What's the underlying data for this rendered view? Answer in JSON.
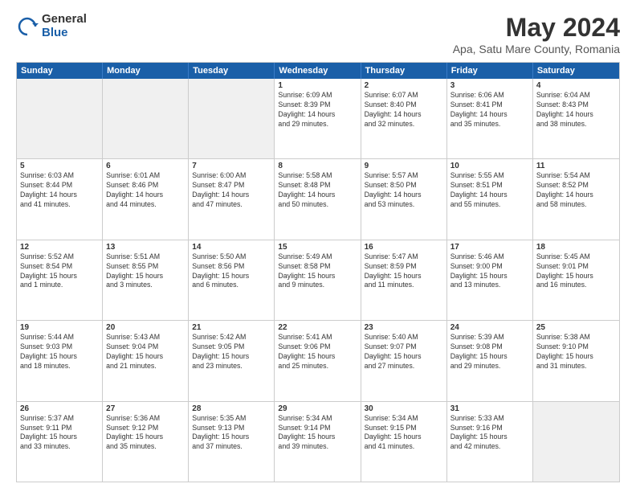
{
  "logo": {
    "general": "General",
    "blue": "Blue"
  },
  "title": "May 2024",
  "subtitle": "Apa, Satu Mare County, Romania",
  "days": [
    "Sunday",
    "Monday",
    "Tuesday",
    "Wednesday",
    "Thursday",
    "Friday",
    "Saturday"
  ],
  "weeks": [
    [
      {
        "day": "",
        "content": "",
        "shaded": true
      },
      {
        "day": "",
        "content": "",
        "shaded": true
      },
      {
        "day": "",
        "content": "",
        "shaded": true
      },
      {
        "day": "1",
        "content": "Sunrise: 6:09 AM\nSunset: 8:39 PM\nDaylight: 14 hours\nand 29 minutes."
      },
      {
        "day": "2",
        "content": "Sunrise: 6:07 AM\nSunset: 8:40 PM\nDaylight: 14 hours\nand 32 minutes."
      },
      {
        "day": "3",
        "content": "Sunrise: 6:06 AM\nSunset: 8:41 PM\nDaylight: 14 hours\nand 35 minutes."
      },
      {
        "day": "4",
        "content": "Sunrise: 6:04 AM\nSunset: 8:43 PM\nDaylight: 14 hours\nand 38 minutes."
      }
    ],
    [
      {
        "day": "5",
        "content": "Sunrise: 6:03 AM\nSunset: 8:44 PM\nDaylight: 14 hours\nand 41 minutes."
      },
      {
        "day": "6",
        "content": "Sunrise: 6:01 AM\nSunset: 8:46 PM\nDaylight: 14 hours\nand 44 minutes."
      },
      {
        "day": "7",
        "content": "Sunrise: 6:00 AM\nSunset: 8:47 PM\nDaylight: 14 hours\nand 47 minutes."
      },
      {
        "day": "8",
        "content": "Sunrise: 5:58 AM\nSunset: 8:48 PM\nDaylight: 14 hours\nand 50 minutes."
      },
      {
        "day": "9",
        "content": "Sunrise: 5:57 AM\nSunset: 8:50 PM\nDaylight: 14 hours\nand 53 minutes."
      },
      {
        "day": "10",
        "content": "Sunrise: 5:55 AM\nSunset: 8:51 PM\nDaylight: 14 hours\nand 55 minutes."
      },
      {
        "day": "11",
        "content": "Sunrise: 5:54 AM\nSunset: 8:52 PM\nDaylight: 14 hours\nand 58 minutes."
      }
    ],
    [
      {
        "day": "12",
        "content": "Sunrise: 5:52 AM\nSunset: 8:54 PM\nDaylight: 15 hours\nand 1 minute."
      },
      {
        "day": "13",
        "content": "Sunrise: 5:51 AM\nSunset: 8:55 PM\nDaylight: 15 hours\nand 3 minutes."
      },
      {
        "day": "14",
        "content": "Sunrise: 5:50 AM\nSunset: 8:56 PM\nDaylight: 15 hours\nand 6 minutes."
      },
      {
        "day": "15",
        "content": "Sunrise: 5:49 AM\nSunset: 8:58 PM\nDaylight: 15 hours\nand 9 minutes."
      },
      {
        "day": "16",
        "content": "Sunrise: 5:47 AM\nSunset: 8:59 PM\nDaylight: 15 hours\nand 11 minutes."
      },
      {
        "day": "17",
        "content": "Sunrise: 5:46 AM\nSunset: 9:00 PM\nDaylight: 15 hours\nand 13 minutes."
      },
      {
        "day": "18",
        "content": "Sunrise: 5:45 AM\nSunset: 9:01 PM\nDaylight: 15 hours\nand 16 minutes."
      }
    ],
    [
      {
        "day": "19",
        "content": "Sunrise: 5:44 AM\nSunset: 9:03 PM\nDaylight: 15 hours\nand 18 minutes."
      },
      {
        "day": "20",
        "content": "Sunrise: 5:43 AM\nSunset: 9:04 PM\nDaylight: 15 hours\nand 21 minutes."
      },
      {
        "day": "21",
        "content": "Sunrise: 5:42 AM\nSunset: 9:05 PM\nDaylight: 15 hours\nand 23 minutes."
      },
      {
        "day": "22",
        "content": "Sunrise: 5:41 AM\nSunset: 9:06 PM\nDaylight: 15 hours\nand 25 minutes."
      },
      {
        "day": "23",
        "content": "Sunrise: 5:40 AM\nSunset: 9:07 PM\nDaylight: 15 hours\nand 27 minutes."
      },
      {
        "day": "24",
        "content": "Sunrise: 5:39 AM\nSunset: 9:08 PM\nDaylight: 15 hours\nand 29 minutes."
      },
      {
        "day": "25",
        "content": "Sunrise: 5:38 AM\nSunset: 9:10 PM\nDaylight: 15 hours\nand 31 minutes."
      }
    ],
    [
      {
        "day": "26",
        "content": "Sunrise: 5:37 AM\nSunset: 9:11 PM\nDaylight: 15 hours\nand 33 minutes."
      },
      {
        "day": "27",
        "content": "Sunrise: 5:36 AM\nSunset: 9:12 PM\nDaylight: 15 hours\nand 35 minutes."
      },
      {
        "day": "28",
        "content": "Sunrise: 5:35 AM\nSunset: 9:13 PM\nDaylight: 15 hours\nand 37 minutes."
      },
      {
        "day": "29",
        "content": "Sunrise: 5:34 AM\nSunset: 9:14 PM\nDaylight: 15 hours\nand 39 minutes."
      },
      {
        "day": "30",
        "content": "Sunrise: 5:34 AM\nSunset: 9:15 PM\nDaylight: 15 hours\nand 41 minutes."
      },
      {
        "day": "31",
        "content": "Sunrise: 5:33 AM\nSunset: 9:16 PM\nDaylight: 15 hours\nand 42 minutes."
      },
      {
        "day": "",
        "content": "",
        "shaded": true
      }
    ]
  ]
}
